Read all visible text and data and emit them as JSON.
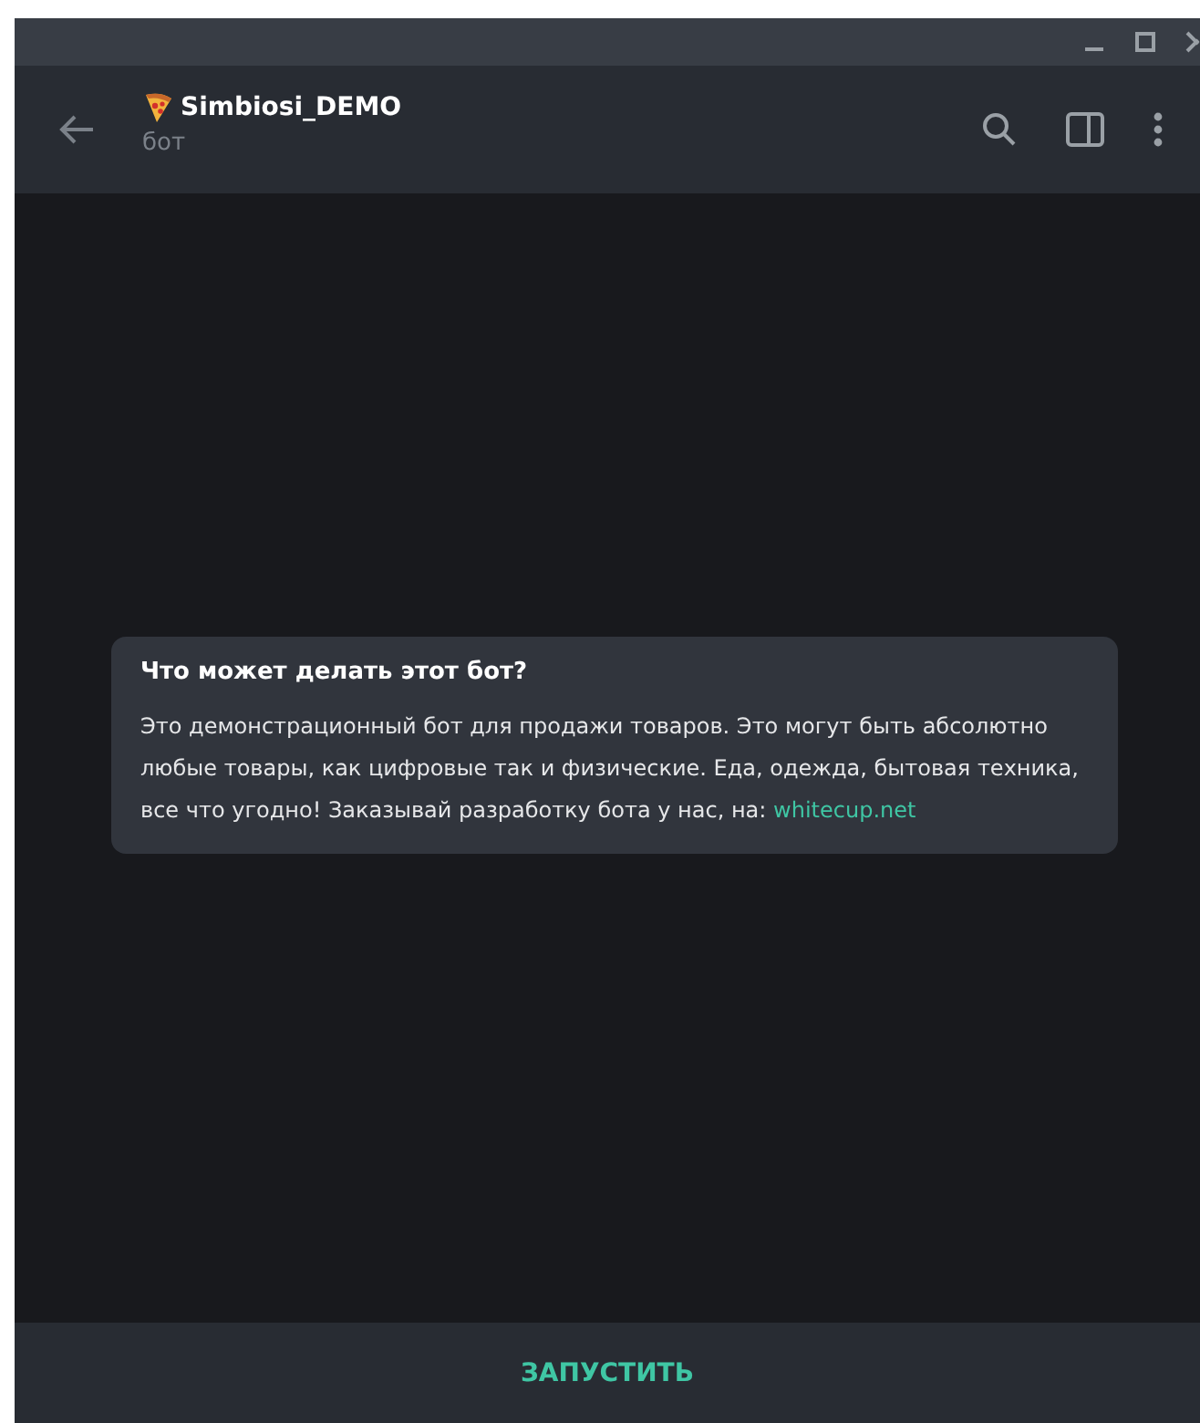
{
  "chat": {
    "title": "Simbiosi_DEMO",
    "subtitle": "бот"
  },
  "info_card": {
    "heading": "Что может делать этот бот?",
    "text": "Это демонстрационный бот для продажи товаров. Это могут быть абсолютно любые товары, как цифровые так и физические. Еда, одежда, бытовая техника, все что угодно! Заказывай разработку бота у нас, на: ",
    "link": "whitecup.net"
  },
  "start_button": {
    "label": "ЗАПУСТИТЬ"
  }
}
